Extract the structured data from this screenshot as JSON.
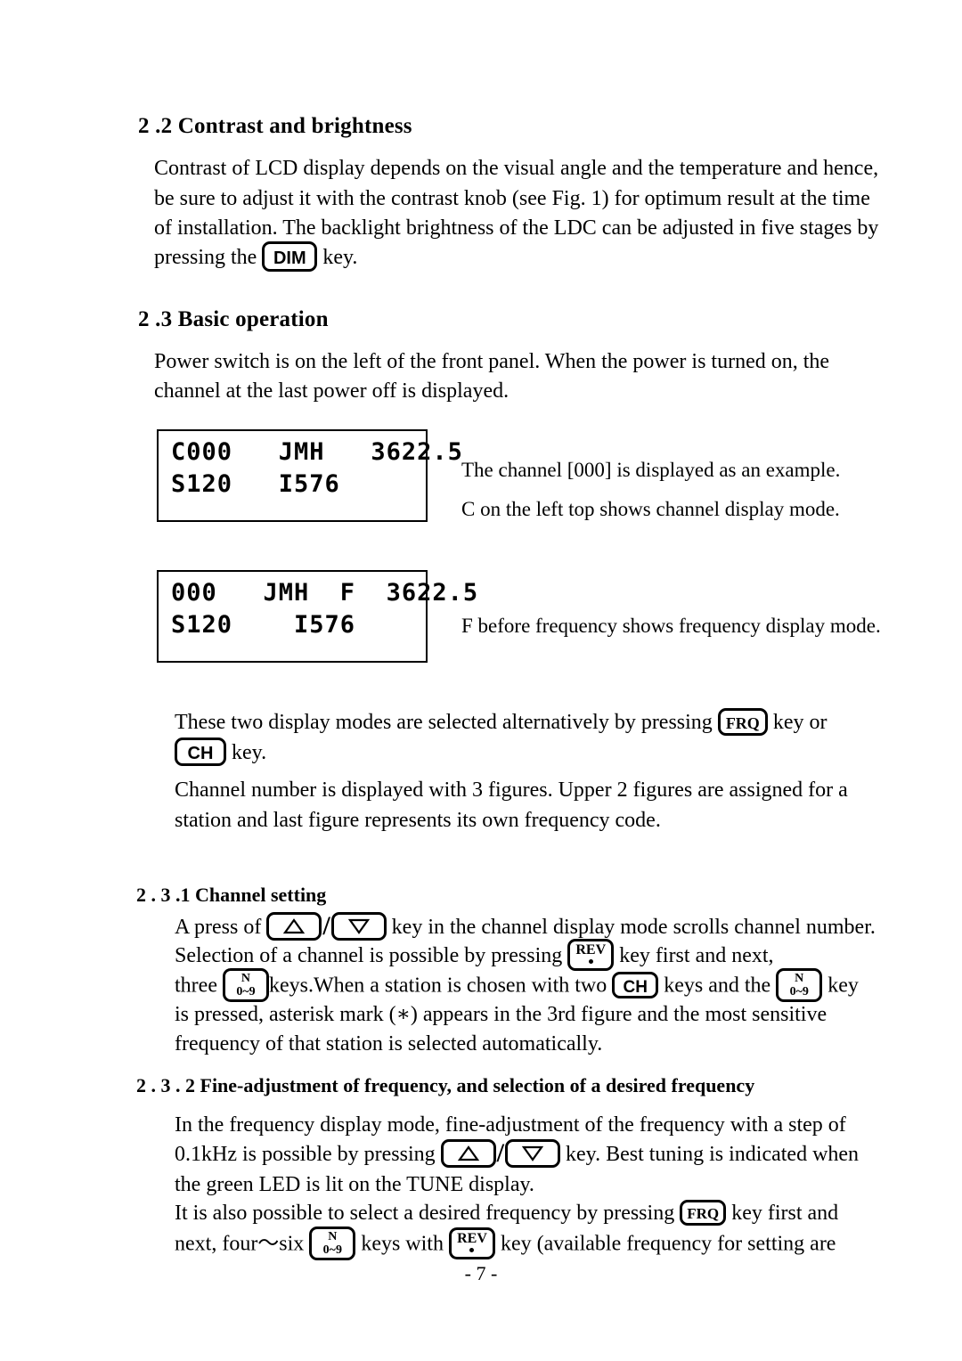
{
  "page": {
    "footer": "- 7 -"
  },
  "section_2_2": {
    "heading": "2 .2 Contrast and brightness",
    "body_lines": [
      "Contrast of LCD display depends on the visual angle and the temperature and hence,",
      "be sure to adjust it with the contrast knob (see Fig. 1) for optimum result at the time",
      "of installation.   The backlight brightness of the LDC can be adjusted in five stages by"
    ],
    "last_line_prefix": "pressing the",
    "last_line_suffix": "key.",
    "dim_key": "DIM"
  },
  "section_2_3": {
    "heading": "2 .3 Basic operation",
    "body_lines": [
      "Power switch is on the left of the front panel.   When the power is turned on, the",
      "channel at the last power off is displayed."
    ],
    "lcd_channel": {
      "line1": "C000   JMH   3622.5",
      "line2": "S120   I576"
    },
    "lcd_channel_captions": [
      "The channel [000] is displayed as an example.",
      "C on the left top shows channel display mode."
    ],
    "lcd_frequency": {
      "line1": "000   JMH  F  3622.5",
      "line2": "S120    I576"
    },
    "lcd_frequency_caption": "F before frequency shows frequency display mode.",
    "modes_line1_prefix": "These  two  display  modes  are  selected  alternatively  by  pressing",
    "modes_frq_key": "FRQ",
    "modes_line1_suffix": "key or",
    "modes_ch_key": "CH",
    "modes_line2_suffix": "key.",
    "channel_number_lines": [
      "Channel number is displayed with 3 figures.   Upper 2 figures are assigned for a",
      "station and last figure represents its own frequency code."
    ]
  },
  "section_2_3_1": {
    "heading": "2 . 3 .1 Channel setting",
    "line1_prefix": "A press of",
    "line1_suffix": "key in the channel display mode scrolls channel number.",
    "line2_prefix": "Selection of a channel is possible by pressing",
    "rev_key": "REV",
    "line2_suffix": "key first and next,",
    "line3_prefix": "three",
    "n_key_top": "N",
    "n_key_bottom": "0~9",
    "line3_mid": "keys.When a station is chosen with two",
    "ch_key": "CH",
    "line3_mid2": "keys and the",
    "line3_suffix": "key",
    "line4": "is  pressed,  asterisk  mark  (∗)  appears  in  the  3rd  figure  and  the  most  sensitive",
    "line5": "frequency of that station is selected automatically."
  },
  "section_2_3_2": {
    "heading": "2 . 3 . 2   Fine-adjustment of frequency, and selection of a desired frequency",
    "line1": "In  the  frequency  display  mode,  fine-adjustment  of  the  frequency  with  a  step  of",
    "line2_prefix": "0.1kHz is possible by pressing",
    "line2_suffix": "key.   Best tuning is indicated when",
    "line3": "the green LED is lit on the TUNE display.",
    "line4_prefix": "It is also possible to select a desired frequency by pressing",
    "frq_key": "FRQ",
    "line4_suffix": "key first and",
    "line5_prefix": "next,  four～six",
    "n_key_top": "N",
    "n_key_bottom": "0~9",
    "line5_mid": "keys  with",
    "rev_key": "REV",
    "line5_suffix": "key  (available  frequency  for  setting  are"
  },
  "icons": {
    "up_arrow": "triangle-up-outline-icon",
    "down_arrow": "triangle-down-outline-icon",
    "rev_dot": "dot-icon"
  },
  "colors": {
    "ink": "#000000",
    "paper": "#ffffff"
  }
}
